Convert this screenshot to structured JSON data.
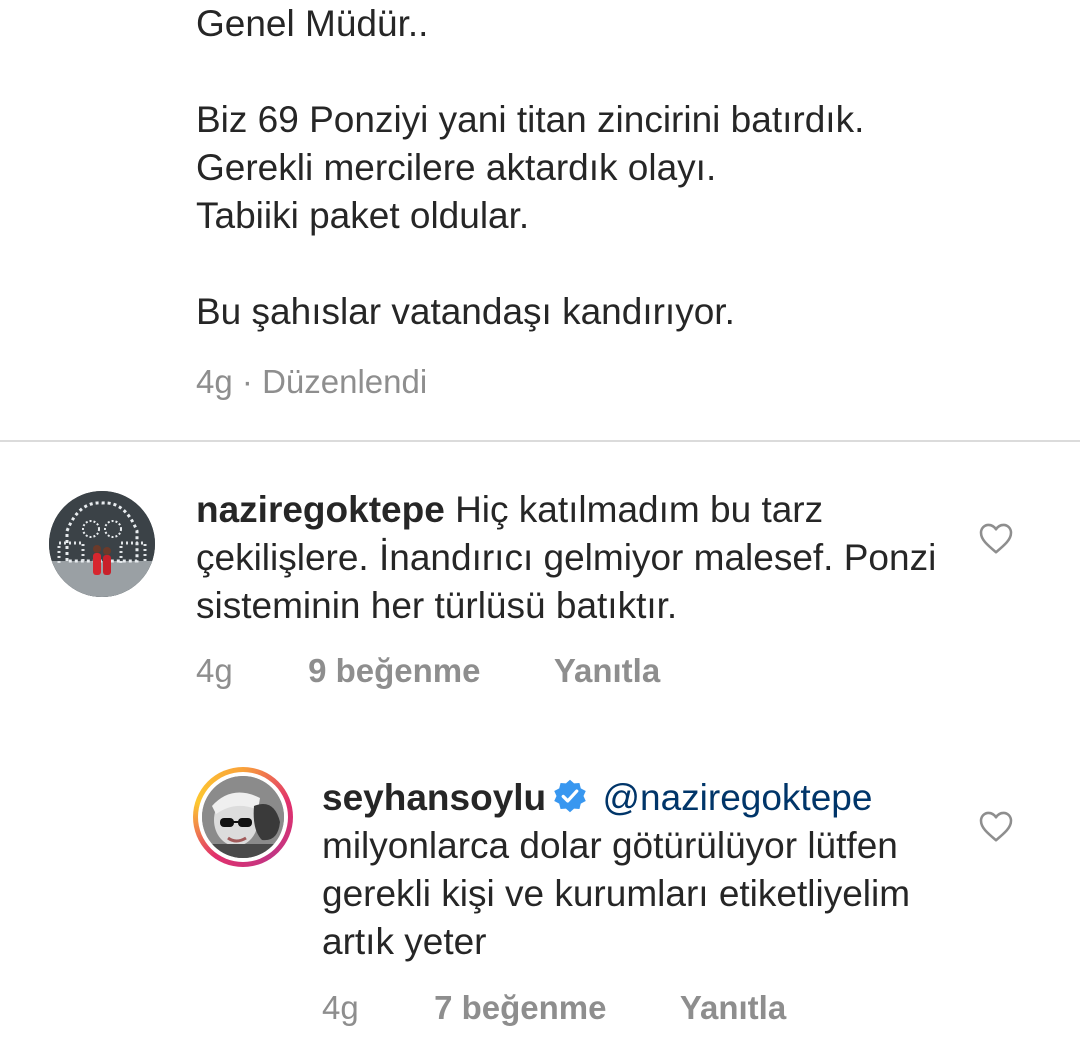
{
  "top_comment": {
    "line1": "Genel Müdür..",
    "line2": "Biz 69 Ponziyi yani titan zincirini batırdık.",
    "line3": "Gerekli mercilere aktardık olayı.",
    "line4": "Tabiiki paket oldular.",
    "line5": "Bu şahıslar vatandaşı kandırıyor.",
    "time": "4g",
    "separator": "·",
    "edited": "Düzenlendi"
  },
  "comments": [
    {
      "username": "naziregoktepe",
      "text": "Hiç katılmadım bu tarz çekilişlere. İnandırıcı gelmiyor malesef. Ponzi sisteminin her türlüsü batıktır.",
      "time": "4g",
      "likes": "9 beğenme",
      "reply": "Yanıtla",
      "avatar_icon": "avatar-photo-icon",
      "like_icon": "heart-outline-icon"
    },
    {
      "username": "seyhansoylu",
      "verified_icon": "verified-badge-icon",
      "mention": "@naziregoktepe",
      "text": "milyonlarca dolar götürülüyor lütfen gerekli kişi ve kurumları etiketliyelim artık yeter",
      "time": "4g",
      "likes": "7 beğenme",
      "reply": "Yanıtla",
      "avatar_icon": "story-ring-avatar-icon",
      "like_icon": "heart-outline-icon"
    }
  ],
  "colors": {
    "text": "#262626",
    "secondary": "#8e8e8e",
    "mention": "#003569",
    "verified": "#3897f0",
    "divider": "#dbdbdb"
  }
}
